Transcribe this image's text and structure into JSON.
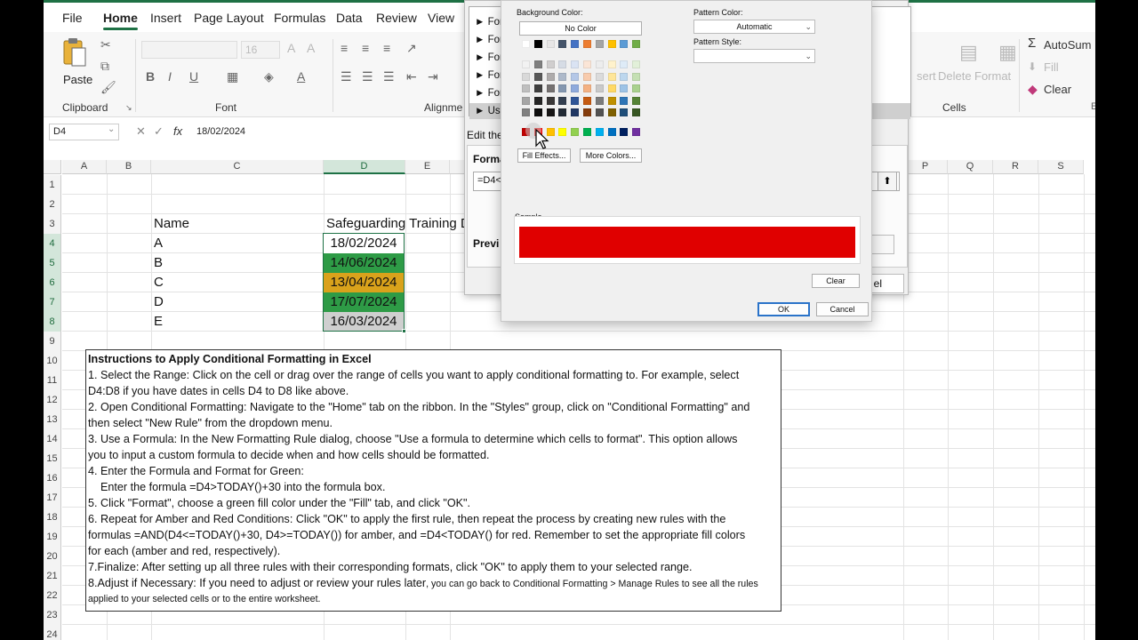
{
  "ribbon": {
    "tabs": [
      "File",
      "Home",
      "Insert",
      "Page Layout",
      "Formulas",
      "Data",
      "Review",
      "View"
    ],
    "active_tab": "Home",
    "clipboard": {
      "paste_label": "Paste",
      "group_label": "Clipboard"
    },
    "font": {
      "name": "",
      "size": "16",
      "group_label": "Font"
    },
    "alignment_group_label": "Alignme",
    "cells": {
      "insert_label": "sert",
      "delete_label": "Delete",
      "format_label": "Format",
      "group_label": "Cells"
    },
    "editing": {
      "autosum_label": "AutoSum",
      "fill_label": "Fill",
      "clear_label": "Clear"
    }
  },
  "formula_bar": {
    "name_box": "D4",
    "fx_label": "fx",
    "value": "18/02/2024"
  },
  "grid": {
    "columns": [
      "A",
      "B",
      "C",
      "D",
      "E",
      "P",
      "Q",
      "R",
      "S"
    ],
    "selected_column": "D",
    "rows": [
      "1",
      "2",
      "3",
      "4",
      "5",
      "6",
      "7",
      "8",
      "9",
      "10",
      "11",
      "12",
      "13",
      "14",
      "15",
      "16",
      "17",
      "18",
      "19",
      "20",
      "21",
      "22",
      "23",
      "24"
    ],
    "headers": {
      "name": "Name",
      "training": "Safeguarding Training D"
    },
    "records": [
      {
        "name": "A",
        "date": "18/02/2024",
        "status": "none"
      },
      {
        "name": "B",
        "date": "14/06/2024",
        "status": "green"
      },
      {
        "name": "C",
        "date": "13/04/2024",
        "status": "amber"
      },
      {
        "name": "D",
        "date": "17/07/2024",
        "status": "green"
      },
      {
        "name": "E",
        "date": "16/03/2024",
        "status": "gray"
      }
    ],
    "status_colors": {
      "green": "#2e9b46",
      "amber": "#d9a21b",
      "gray": "#cfcfcf",
      "none": "#ffffff"
    }
  },
  "instructions": {
    "title": "Instructions to Apply Conditional Formatting in Excel",
    "lines": [
      "1. Select the Range: Click on the cell or drag over the range of cells you want to apply conditional formatting to. For example, select",
      "D4:D8 if you have dates in cells D4 to D8 like above.",
      "2. Open Conditional Formatting: Navigate to the \"Home\" tab on the ribbon. In the \"Styles\" group, click on \"Conditional Formatting\" and",
      "then select \"New Rule\" from the dropdown menu.",
      "3. Use a Formula: In the New Formatting Rule dialog, choose \"Use a formula to determine which cells to format\". This option allows",
      "you to input a custom formula to decide when and how cells should be formatted.",
      "4. Enter the Formula and Format for Green:",
      "    Enter the formula =D4>TODAY()+30 into the formula box.",
      "5. Click \"Format\", choose a green fill color under the \"Fill\" tab, and click \"OK\".",
      "6. Repeat for Amber and Red Conditions: Click \"OK\" to apply the first rule, then repeat the process by creating new rules with the",
      "formulas =AND(D4<=TODAY()+30, D4>=TODAY()) for amber, and =D4<TODAY() for red. Remember to set the appropriate fill colors",
      "for each (amber and red, respectively).",
      "7.Finalize: After setting up all three rules with their corresponding formats, click \"OK\" to apply them to your selected range."
    ],
    "line8_main": "8.Adjust if Necessary: If you need to adjust or review your rules later",
    "line8_small": ", you can go back to Conditional Formatting > Manage Rules to see all the rules",
    "line9_small": "applied to your selected cells or to the entire worksheet."
  },
  "rule_dialog": {
    "rule_items": [
      "For",
      "For",
      "For",
      "For",
      "For",
      "Use"
    ],
    "edit_label": "Edit the",
    "format_label": "Forma",
    "formula_value": "=D4<",
    "preview_label": "Previ",
    "cancel_partial": "el"
  },
  "color_dialog": {
    "background_color_label": "Background Color:",
    "no_color_label": "No Color",
    "pattern_color_label": "Pattern Color:",
    "pattern_color_value": "Automatic",
    "pattern_style_label": "Pattern Style:",
    "fill_effects_label": "Fill Effects...",
    "more_colors_label": "More Colors...",
    "sample_label": "Sample",
    "sample_color": "#e00000",
    "clear_label": "Clear",
    "ok_label": "OK",
    "cancel_label": "Cancel",
    "top_row": [
      "#ffffff",
      "#000000",
      "#e7e6e6",
      "#44546a",
      "#4472c4",
      "#ed7d31",
      "#a5a5a5",
      "#ffc000",
      "#5b9bd5",
      "#70ad47"
    ],
    "theme_columns": [
      [
        "#f2f2f2",
        "#d9d9d9",
        "#bfbfbf",
        "#a6a6a6",
        "#808080"
      ],
      [
        "#7f7f7f",
        "#595959",
        "#404040",
        "#262626",
        "#0d0d0d"
      ],
      [
        "#d0cece",
        "#aeabab",
        "#757171",
        "#3a3838",
        "#171616"
      ],
      [
        "#d6dce5",
        "#adb9ca",
        "#8497b0",
        "#333f50",
        "#222a35"
      ],
      [
        "#dae3f3",
        "#b4c7e7",
        "#8faadc",
        "#2f5597",
        "#203864"
      ],
      [
        "#fbe5d6",
        "#f8cbad",
        "#f4b183",
        "#c55a11",
        "#843c0c"
      ],
      [
        "#ededed",
        "#dbdbdb",
        "#c9c9c9",
        "#7b7b7b",
        "#525252"
      ],
      [
        "#fff2cc",
        "#ffe699",
        "#ffd966",
        "#bf9000",
        "#7f6000"
      ],
      [
        "#deebf7",
        "#bdd7ee",
        "#9dc3e6",
        "#2e75b6",
        "#1f4e79"
      ],
      [
        "#e2f0d9",
        "#c5e0b4",
        "#a9d18e",
        "#548235",
        "#385723"
      ]
    ],
    "standard_colors": [
      "#c00000",
      "#ff0000",
      "#ffc000",
      "#ffff00",
      "#92d050",
      "#00b050",
      "#00b0f0",
      "#0070c0",
      "#002060",
      "#7030a0"
    ]
  }
}
